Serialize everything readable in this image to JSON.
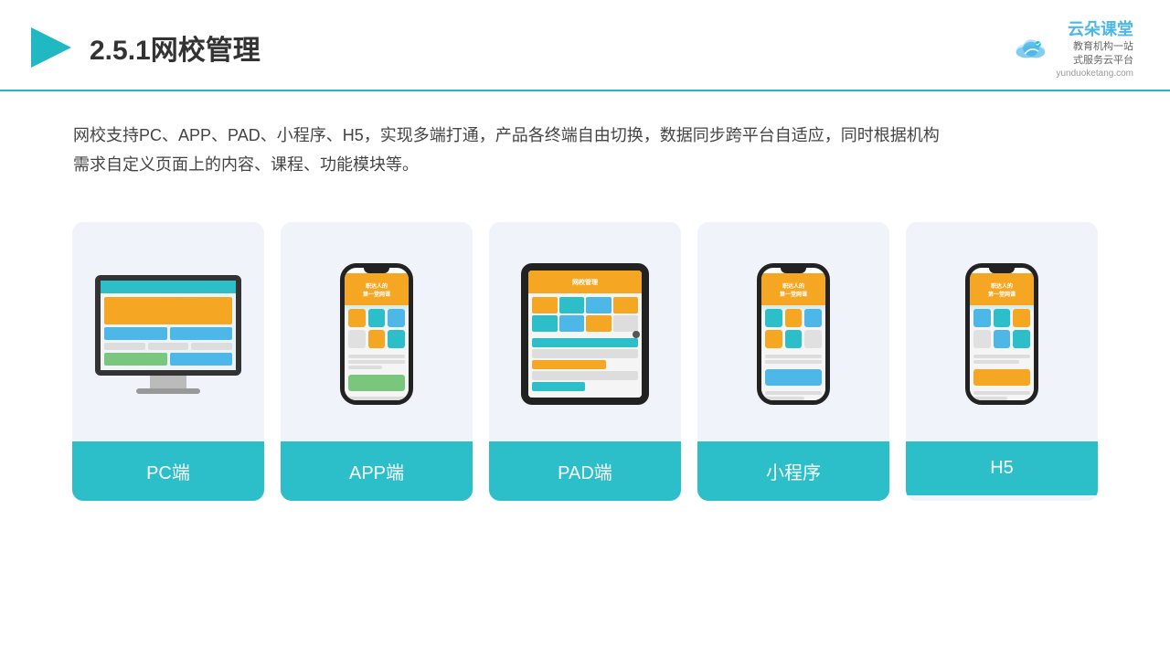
{
  "header": {
    "title": "2.5.1网校管理",
    "brand_name": "云朵课堂",
    "brand_tagline": "教育机构一站\n式服务云平台",
    "brand_url": "yunduoketang.com"
  },
  "description": {
    "text_line1": "网校支持PC、APP、PAD、小程序、H5，实现多端打通，产品各终端自由切换，数据同步跨平台自适应，同时根据机构",
    "text_line2": "需求自定义页面上的内容、课程、功能模块等。"
  },
  "cards": [
    {
      "label": "PC端",
      "type": "pc"
    },
    {
      "label": "APP端",
      "type": "phone"
    },
    {
      "label": "PAD端",
      "type": "tablet"
    },
    {
      "label": "小程序",
      "type": "phone_mini"
    },
    {
      "label": "H5",
      "type": "phone_mini2"
    }
  ]
}
